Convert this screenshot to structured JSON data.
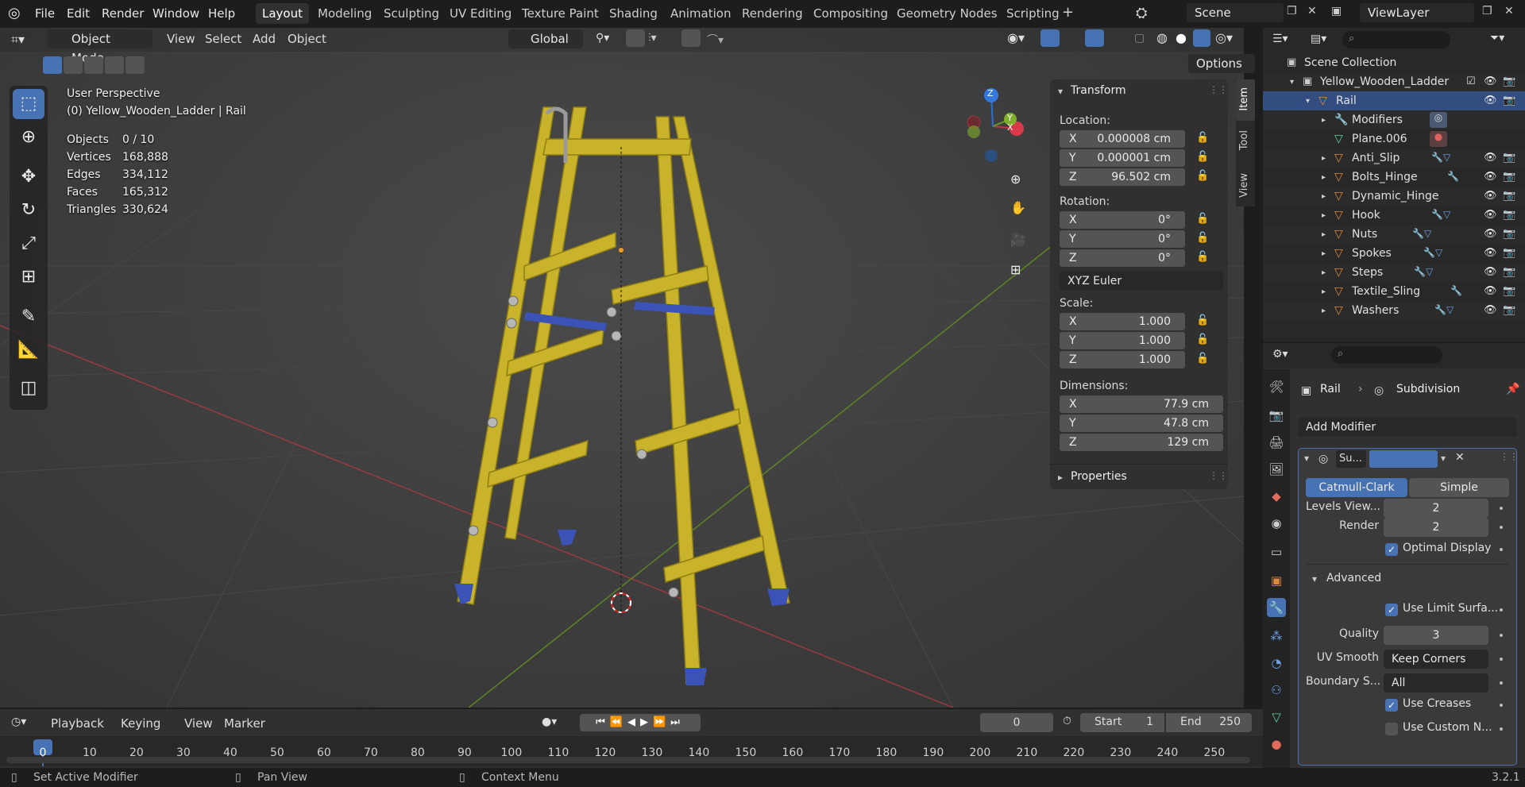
{
  "topbar": {
    "menus": [
      "File",
      "Edit",
      "Render",
      "Window",
      "Help"
    ],
    "workspaces": [
      "Layout",
      "Modeling",
      "Sculpting",
      "UV Editing",
      "Texture Paint",
      "Shading",
      "Animation",
      "Rendering",
      "Compositing",
      "Geometry Nodes",
      "Scripting"
    ],
    "active_workspace": "Layout",
    "add_tab": "+",
    "scene": "Scene",
    "view_layer": "ViewLayer"
  },
  "viewport": {
    "mode": "Object Mode",
    "menus": [
      "View",
      "Select",
      "Add",
      "Object"
    ],
    "transform_orientation": "Global",
    "options": "Options",
    "view_name": "User Perspective",
    "object_info": "(0) Yellow_Wooden_Ladder | Rail",
    "stats": [
      {
        "label": "Objects",
        "value": "0 / 10"
      },
      {
        "label": "Vertices",
        "value": "168,888"
      },
      {
        "label": "Edges",
        "value": "334,112"
      },
      {
        "label": "Faces",
        "value": "165,312"
      },
      {
        "label": "Triangles",
        "value": "330,624"
      }
    ],
    "gizmo": {
      "x": "X",
      "y": "Y",
      "z": "Z"
    }
  },
  "npanel": {
    "tabs": [
      "Item",
      "Tool",
      "View"
    ],
    "transform_title": "Transform",
    "location_label": "Location:",
    "location": [
      {
        "axis": "X",
        "value": "0.000008 cm"
      },
      {
        "axis": "Y",
        "value": "0.000001 cm"
      },
      {
        "axis": "Z",
        "value": "96.502 cm"
      }
    ],
    "rotation_label": "Rotation:",
    "rotation": [
      {
        "axis": "X",
        "value": "0°"
      },
      {
        "axis": "Y",
        "value": "0°"
      },
      {
        "axis": "Z",
        "value": "0°"
      }
    ],
    "rotation_mode": "XYZ Euler",
    "scale_label": "Scale:",
    "scale": [
      {
        "axis": "X",
        "value": "1.000"
      },
      {
        "axis": "Y",
        "value": "1.000"
      },
      {
        "axis": "Z",
        "value": "1.000"
      }
    ],
    "dimensions_label": "Dimensions:",
    "dimensions": [
      {
        "axis": "X",
        "value": "77.9 cm"
      },
      {
        "axis": "Y",
        "value": "47.8 cm"
      },
      {
        "axis": "Z",
        "value": "129 cm"
      }
    ],
    "properties_title": "Properties"
  },
  "outliner": {
    "scene_collection": "Scene Collection",
    "collection": "Yellow_Wooden_Ladder",
    "active": "Rail",
    "modifiers": "Modifiers",
    "mesh": "Plane.006",
    "children": [
      "Anti_Slip",
      "Bolts_Hinge",
      "Dynamic_Hinge",
      "Hook",
      "Nuts",
      "Spokes",
      "Steps",
      "Textile_Sling",
      "Washers"
    ]
  },
  "properties": {
    "breadcrumb_object": "Rail",
    "breadcrumb_modifier": "Subdivision",
    "add_modifier": "Add Modifier",
    "modifier_name": "Su...",
    "catmull": "Catmull-Clark",
    "simple": "Simple",
    "levels_viewport_label": "Levels View...",
    "levels_viewport": "2",
    "render_label": "Render",
    "render": "2",
    "optimal_display": "Optimal Display",
    "advanced": "Advanced",
    "use_limit_surface": "Use Limit Surfa...",
    "quality_label": "Quality",
    "quality": "3",
    "uv_smooth_label": "UV Smooth",
    "uv_smooth": "Keep Corners",
    "boundary_label": "Boundary S...",
    "boundary": "All",
    "use_creases": "Use Creases",
    "use_custom_normals": "Use Custom N..."
  },
  "timeline": {
    "menus": [
      "Playback",
      "Keying",
      "View",
      "Marker"
    ],
    "current_frame": "0",
    "start_label": "Start",
    "start": "1",
    "end_label": "End",
    "end": "250",
    "ticks": [
      "0",
      "10",
      "20",
      "30",
      "40",
      "50",
      "60",
      "70",
      "80",
      "90",
      "100",
      "110",
      "120",
      "130",
      "140",
      "150",
      "160",
      "170",
      "180",
      "190",
      "200",
      "210",
      "220",
      "230",
      "240",
      "250"
    ]
  },
  "statusbar": {
    "left": "Set Active Modifier",
    "middle": "Pan View",
    "right": "Context Menu",
    "version": "3.2.1"
  },
  "colors": {
    "accent": "#4772b3",
    "ladder": "#c9b42a",
    "object_icon": "#e0893c",
    "x_axis": "#c03744",
    "y_axis": "#6e9a28",
    "z_axis": "#2e6fd0"
  }
}
